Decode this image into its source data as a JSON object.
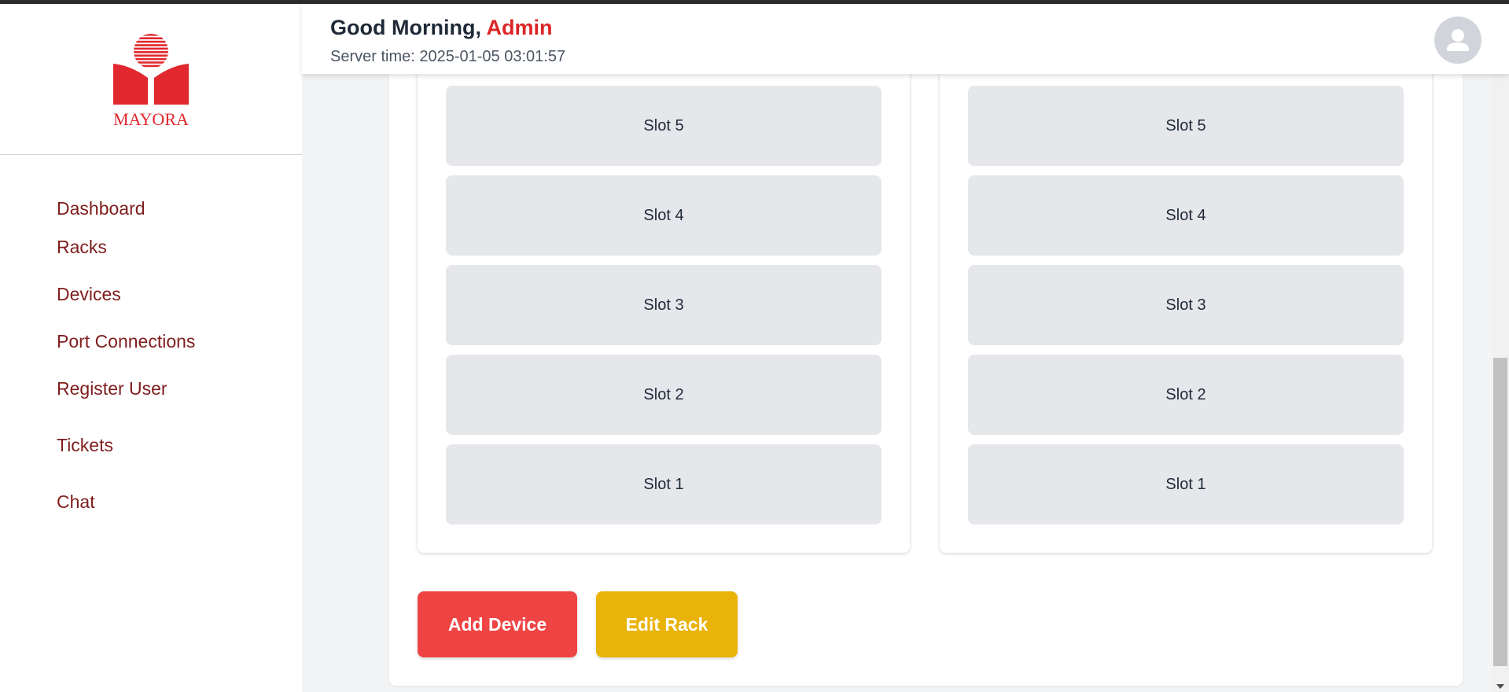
{
  "brand": {
    "logo_text": "MAYORA",
    "logo_color": "#e0282e"
  },
  "header": {
    "greeting_prefix": "Good Morning, ",
    "greeting_name": "Admin",
    "server_time_label": "Server time: ",
    "server_time_value": "2025-01-05 03:01:57",
    "avatar_icon": "user-icon"
  },
  "sidebar": {
    "items": [
      {
        "label": "Dashboard"
      },
      {
        "label": "Racks"
      },
      {
        "label": "Devices"
      },
      {
        "label": "Port Connections"
      },
      {
        "label": "Register User"
      },
      {
        "label": "Tickets"
      },
      {
        "label": "Chat"
      }
    ]
  },
  "racks": [
    {
      "slots": [
        "Slot 5",
        "Slot 4",
        "Slot 3",
        "Slot 2",
        "Slot 1"
      ]
    },
    {
      "slots": [
        "Slot 5",
        "Slot 4",
        "Slot 3",
        "Slot 2",
        "Slot 1"
      ]
    }
  ],
  "actions": {
    "add_device_label": "Add Device",
    "edit_rack_label": "Edit Rack"
  },
  "colors": {
    "accent": "#dc2626",
    "nav_text": "#7f1d1d",
    "add_button": "#ef4444",
    "edit_button": "#eab308",
    "slot_bg": "#e5e7eb"
  }
}
